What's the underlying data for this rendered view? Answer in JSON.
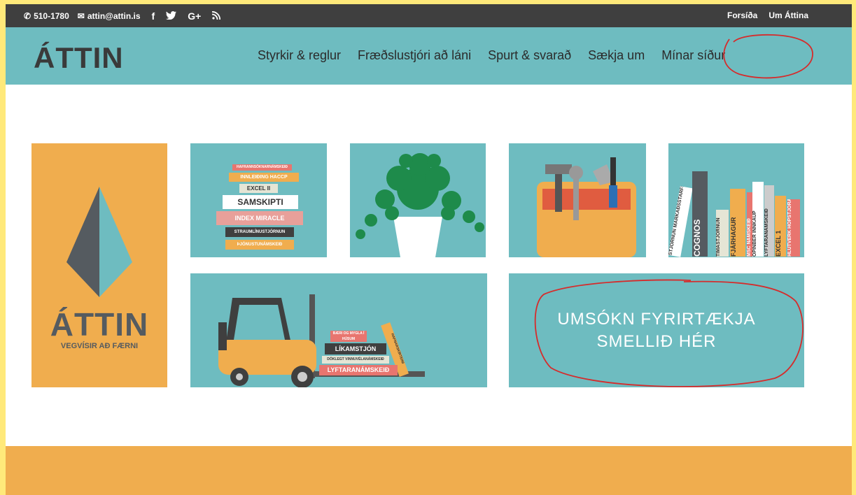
{
  "topbar": {
    "phone": "510-1780",
    "email": "attin@attin.is",
    "social": [
      "f",
      "G+"
    ],
    "links": [
      "Forsíða",
      "Um Áttina"
    ]
  },
  "header": {
    "logo": "ÁTTIN",
    "nav": [
      "Styrkir & reglur",
      "Fræðslustjóri að láni",
      "Spurt & svarað",
      "Sækja um",
      "Mínar síður"
    ]
  },
  "left_panel": {
    "brand": "ÁTTIN",
    "tagline": "VEGVÍSIR AÐ FÆRNI"
  },
  "tile_books": [
    "HAFRANNSÓKNARNÁMSKEIÐ",
    "INNLEIÐING HACCP",
    "EXCEL II",
    "SAMSKIPTI",
    "INDEX MIRACLE",
    "STRAUMLÍNUSTJÓRNUN",
    "ÞJÓNUSTUNÁMSKEIÐ"
  ],
  "tile_shelf": [
    "STJÓRNUN MARKAÐSSTARFS",
    "COGNOS",
    "TÍMASTJÓRNUN",
    "FJÁRHAGUR",
    "MSC NÁMSKEIÐ",
    "OPINBER INNKAUP",
    "LYFTARANÁMSKEIÐ",
    "EXCEL 1",
    "HLUTVERK HÓPSTJÓRANS"
  ],
  "tile_forklift": [
    "BÆRI OG MYGLA Í HÚSUM",
    "HAFNARSKÍRTEINI",
    "LÍKAMSTJÓN",
    "DÓKLEGT VINNUVÉLANÁMSKEIÐ",
    "LYFTARANÁMSKEIÐ"
  ],
  "cta": {
    "line1": "UMSÓKN FYRIRTÆKJA",
    "line2": "SMELLIÐ HÉR"
  },
  "colors": {
    "teal": "#6ebcc0",
    "orange": "#f0ad4e",
    "dark": "#3f3f3f",
    "annotation": "#d62b2b"
  }
}
